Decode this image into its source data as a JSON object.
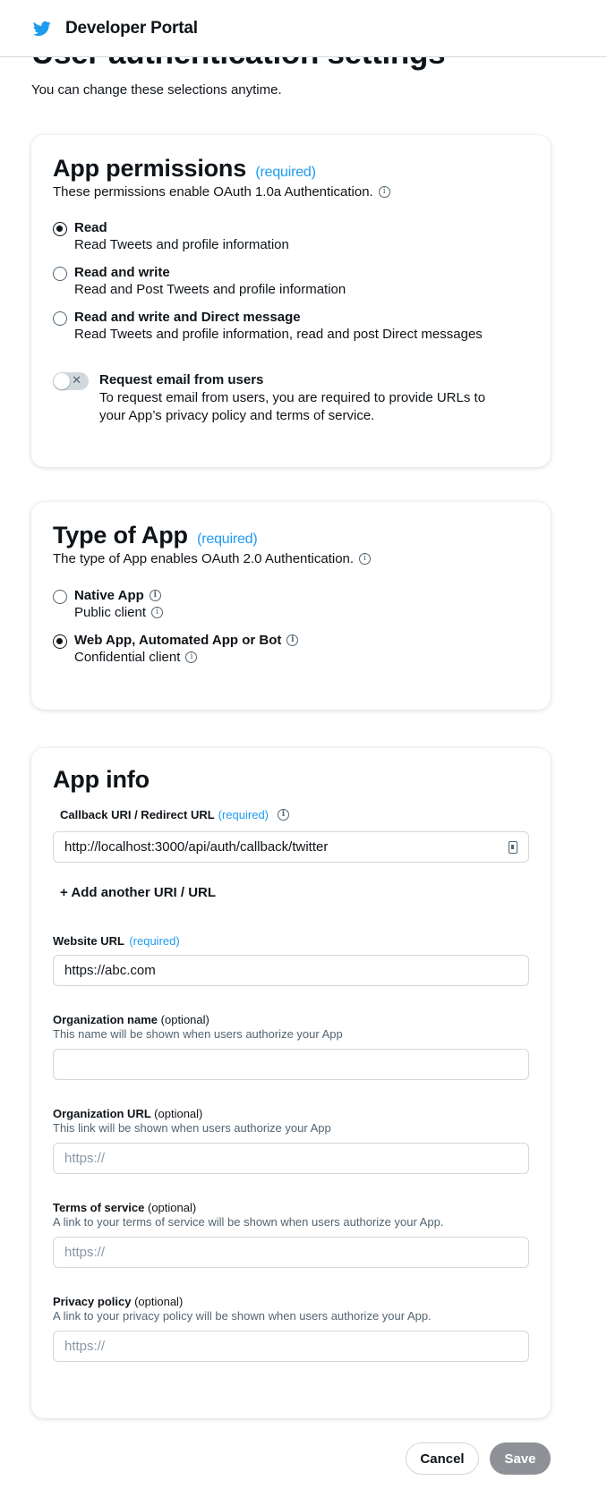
{
  "header": {
    "brand": "Developer Portal",
    "logo_icon": "twitter-bird-icon",
    "brand_color": "#1d9bf0"
  },
  "page": {
    "title": "User authentication settings",
    "subtitle": "You can change these selections anytime."
  },
  "app_permissions": {
    "title": "App permissions",
    "required": "(required)",
    "description": "These permissions enable OAuth 1.0a Authentication.",
    "options": [
      {
        "label": "Read",
        "desc": "Read Tweets and profile information",
        "selected": true
      },
      {
        "label": "Read and write",
        "desc": "Read and Post Tweets and profile information",
        "selected": false
      },
      {
        "label": "Read and write and Direct message",
        "desc": "Read Tweets and profile information, read and post Direct messages",
        "selected": false
      }
    ],
    "email_toggle": {
      "label": "Request email from users",
      "desc": "To request email from users, you are required to provide URLs to your App’s privacy policy and terms of service.",
      "enabled": false
    }
  },
  "type_of_app": {
    "title": "Type of App",
    "required": "(required)",
    "description": "The type of App enables OAuth 2.0 Authentication.",
    "options": [
      {
        "label": "Native App",
        "desc": "Public client",
        "selected": false
      },
      {
        "label": "Web App, Automated App or Bot",
        "desc": "Confidential client",
        "selected": true
      }
    ]
  },
  "app_info": {
    "title": "App info",
    "callback": {
      "label": "Callback URI / Redirect URL",
      "required": "(required)",
      "value": "http://localhost:3000/api/auth/callback/twitter"
    },
    "add_uri": "+ Add another URI / URL",
    "website": {
      "label": "Website URL",
      "required": "(required)",
      "value": "https://abc.com"
    },
    "org_name": {
      "label": "Organization name",
      "optional": "(optional)",
      "help": "This name will be shown when users authorize your App",
      "value": ""
    },
    "org_url": {
      "label": "Organization URL",
      "optional": "(optional)",
      "help": "This link will be shown when users authorize your App",
      "placeholder": "https://"
    },
    "tos": {
      "label": "Terms of service",
      "optional": "(optional)",
      "help": "A link to your terms of service will be shown when users authorize your App.",
      "placeholder": "https://"
    },
    "privacy": {
      "label": "Privacy policy",
      "optional": "(optional)",
      "help": "A link to your privacy policy will be shown when users authorize your App.",
      "placeholder": "https://"
    }
  },
  "footer": {
    "cancel": "Cancel",
    "save": "Save"
  }
}
